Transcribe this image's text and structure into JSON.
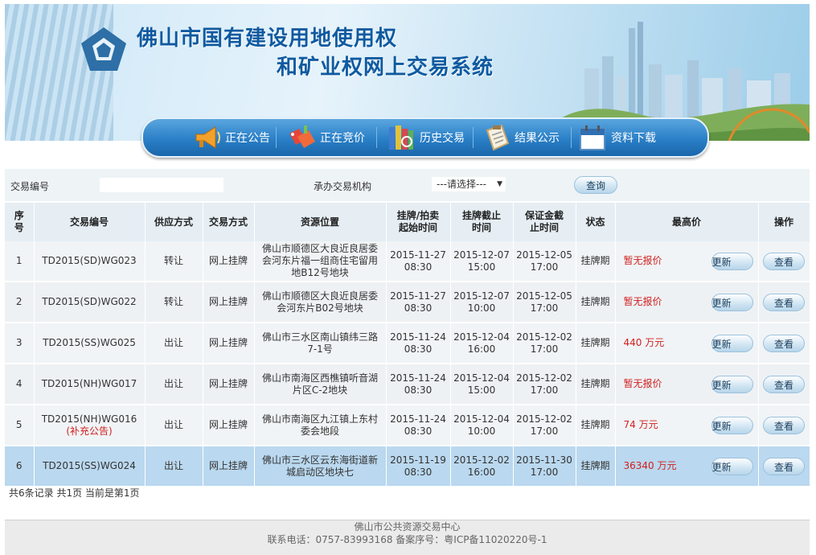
{
  "header": {
    "title_line1": "佛山市国有建设用地使用权",
    "title_line2": "和矿业权网上交易系统"
  },
  "nav": {
    "items": [
      {
        "label": "正在公告",
        "icon": "megaphone-icon"
      },
      {
        "label": "正在竞价",
        "icon": "sale-tag-icon"
      },
      {
        "label": "历史交易",
        "icon": "books-icon"
      },
      {
        "label": "结果公示",
        "icon": "clipboard-icon"
      },
      {
        "label": "资料下载",
        "icon": "calendar-icon"
      }
    ]
  },
  "search": {
    "trade_no_label": "交易编号",
    "trade_no_value": "",
    "agency_label": "承办交易机构",
    "agency_selected": "---请选择---",
    "query_label": "查询"
  },
  "table": {
    "headers": {
      "seq": "序号",
      "trade_no": "交易编号",
      "supply": "供应方式",
      "trade_mode": "交易方式",
      "location": "资源位置",
      "start": "挂牌/拍卖起始时间",
      "end": "挂牌截止时间",
      "deposit": "保证金截止时间",
      "status": "状态",
      "price": "最高价",
      "action": "操作"
    },
    "update_label": "更新",
    "view_label": "查看",
    "rows": [
      {
        "seq": "1",
        "trade_no": "TD2015(SD)WG023",
        "note": "",
        "supply": "转让",
        "mode": "网上挂牌",
        "location": "佛山市顺德区大良近良居委会河东片福一组商住宅留用地B12号地块",
        "start_date": "2015-11-27",
        "start_time": "08:30",
        "end_date": "2015-12-07",
        "end_time": "15:00",
        "dep_date": "2015-12-05",
        "dep_time": "17:00",
        "status": "挂牌期",
        "price": "暂无报价"
      },
      {
        "seq": "2",
        "trade_no": "TD2015(SD)WG022",
        "note": "",
        "supply": "转让",
        "mode": "网上挂牌",
        "location": "佛山市顺德区大良近良居委会河东片B02号地块",
        "start_date": "2015-11-27",
        "start_time": "08:30",
        "end_date": "2015-12-07",
        "end_time": "10:00",
        "dep_date": "2015-12-05",
        "dep_time": "17:00",
        "status": "挂牌期",
        "price": "暂无报价"
      },
      {
        "seq": "3",
        "trade_no": "TD2015(SS)WG025",
        "note": "",
        "supply": "出让",
        "mode": "网上挂牌",
        "location": "佛山市三水区南山镇纬三路7-1号",
        "start_date": "2015-11-24",
        "start_time": "08:30",
        "end_date": "2015-12-04",
        "end_time": "16:00",
        "dep_date": "2015-12-02",
        "dep_time": "17:00",
        "status": "挂牌期",
        "price": "440 万元"
      },
      {
        "seq": "4",
        "trade_no": "TD2015(NH)WG017",
        "note": "",
        "supply": "出让",
        "mode": "网上挂牌",
        "location": "佛山市南海区西樵镇听音湖片区C-2地块",
        "start_date": "2015-11-24",
        "start_time": "08:30",
        "end_date": "2015-12-04",
        "end_time": "15:00",
        "dep_date": "2015-12-02",
        "dep_time": "17:00",
        "status": "挂牌期",
        "price": "暂无报价"
      },
      {
        "seq": "5",
        "trade_no": "TD2015(NH)WG016",
        "note": "(补充公告)",
        "supply": "出让",
        "mode": "网上挂牌",
        "location": "佛山市南海区九江镇上东村委会地段",
        "start_date": "2015-11-24",
        "start_time": "08:30",
        "end_date": "2015-12-04",
        "end_time": "10:00",
        "dep_date": "2015-12-02",
        "dep_time": "17:00",
        "status": "挂牌期",
        "price": "74 万元"
      },
      {
        "seq": "6",
        "trade_no": "TD2015(SS)WG024",
        "note": "",
        "supply": "出让",
        "mode": "网上挂牌",
        "location": "佛山市三水区云东海街道新城启动区地块七",
        "start_date": "2015-11-19",
        "start_time": "08:30",
        "end_date": "2015-12-02",
        "end_time": "16:00",
        "dep_date": "2015-11-30",
        "dep_time": "17:00",
        "status": "挂牌期",
        "price": "36340 万元"
      }
    ]
  },
  "pager": {
    "summary": "共6条记录 共1页 当前是第1页"
  },
  "footer": {
    "org": "佛山市公共资源交易中心",
    "contact": "联系电话：0757-83993168 备案序号：粤ICP备11020220号-1"
  },
  "colors": {
    "accent": "#2a7fc6",
    "price_red": "#d11f1f",
    "selected_row": "#bad8ef"
  }
}
